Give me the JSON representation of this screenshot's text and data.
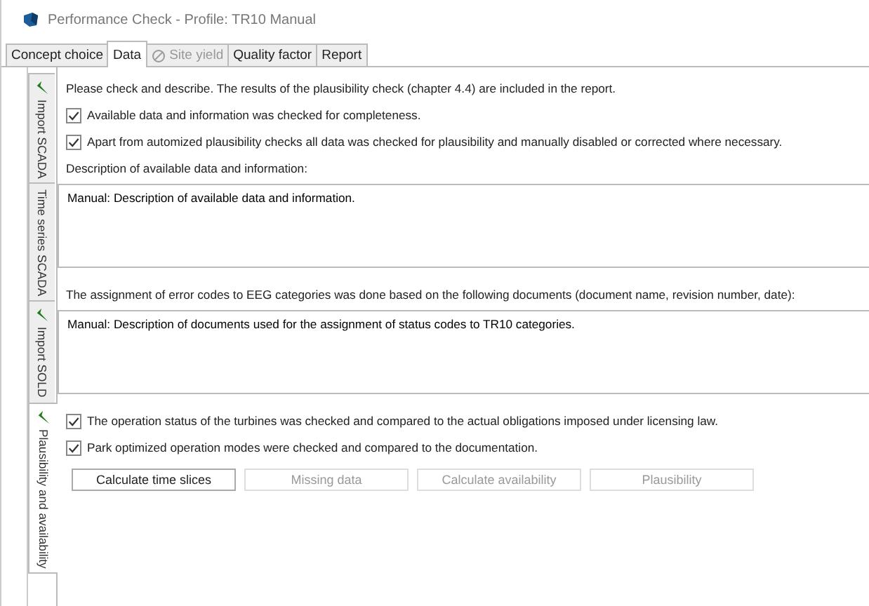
{
  "window": {
    "title": "Performance Check - Profile: TR10 Manual"
  },
  "tabs": [
    {
      "label": "Concept choice",
      "selected": false,
      "disabled": false
    },
    {
      "label": "Data",
      "selected": true,
      "disabled": false
    },
    {
      "label": "Site yield",
      "selected": false,
      "disabled": true
    },
    {
      "label": "Quality factor",
      "selected": false,
      "disabled": false
    },
    {
      "label": "Report",
      "selected": false,
      "disabled": false
    }
  ],
  "side_tabs": [
    {
      "label": "Import SCADA",
      "selected": false,
      "done": true
    },
    {
      "label": "Time series SCADA",
      "selected": false,
      "done": false
    },
    {
      "label": "Import SOLD",
      "selected": false,
      "done": true
    },
    {
      "label": "Plausibility and availability",
      "selected": true,
      "done": true
    }
  ],
  "content": [
    {
      "kind": "text",
      "text": "Please check and describe. The results of the plausibility check (chapter 4.4) are included in the report."
    },
    {
      "kind": "checkbox",
      "text": "Available data and information was checked for completeness.",
      "checked": true
    },
    {
      "kind": "checkbox",
      "text": "Apart from automized plausibility checks all data was checked for plausibility and manually disabled or corrected where necessary.",
      "checked": true
    },
    {
      "kind": "text",
      "text": "Description of available data and information:"
    },
    {
      "kind": "field",
      "value": "Manual: Description of available data and information."
    },
    {
      "kind": "text",
      "text": "The assignment of error codes to EEG categories was done based on the following documents (document name, revision number, date):"
    },
    {
      "kind": "field",
      "value": "Manual: Description of documents used for the assignment of status codes to TR10 categories."
    },
    {
      "kind": "checkbox",
      "text": "The operation status of the turbines was checked and compared to the actual obligations imposed under licensing law.",
      "checked": true
    },
    {
      "kind": "checkbox",
      "text": "Park optimized operation modes were checked and compared to the documentation.",
      "checked": true
    }
  ],
  "buttons": [
    {
      "label": "Calculate time slices",
      "disabled": false
    },
    {
      "label": "Missing data",
      "disabled": true
    },
    {
      "label": "Calculate availability",
      "disabled": true
    },
    {
      "label": "Plausibility",
      "disabled": true
    }
  ]
}
